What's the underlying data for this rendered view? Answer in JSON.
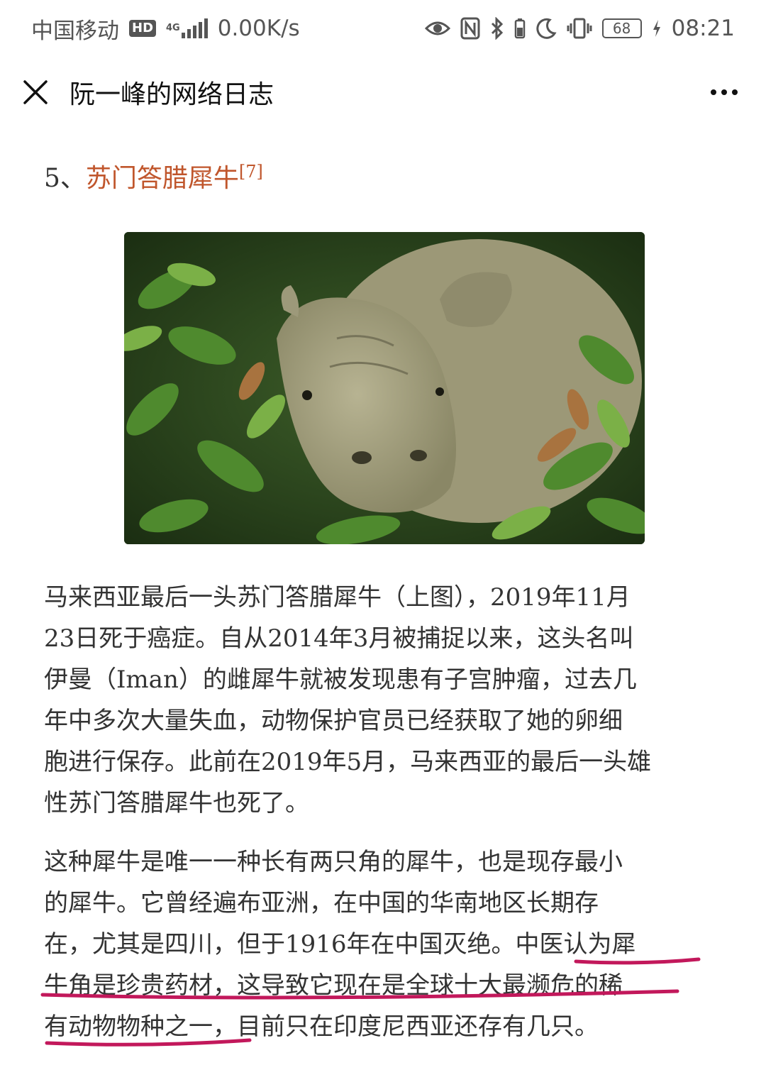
{
  "status_bar": {
    "carrier": "中国移动",
    "hd_badge": "HD",
    "network": "4G",
    "speed": "0.00K/s",
    "battery": "68",
    "time": "08:21",
    "icons": [
      "eye-icon",
      "nfc-icon",
      "bluetooth-icon",
      "moon-icon",
      "vibrate-icon",
      "battery-icon",
      "charging-icon"
    ]
  },
  "header": {
    "title": "阮一峰的网络日志",
    "close_icon": "close-icon",
    "more_icon": "more-icon"
  },
  "article": {
    "section_number": "5、",
    "section_link": "苏门答腊犀牛",
    "section_ref": "[7]",
    "photo": "rhinoceros-photo",
    "paragraph1_lines": [
      "马来西亚最后一头苏门答腊犀牛（上图），2019年11月",
      "23日死于癌症。自从2014年3月被捕捉以来，这头名叫",
      "伊曼（Iman）的雌犀牛就被发现患有子宫肿瘤，过去几",
      "年中多次大量失血，动物保护官员已经获取了她的卵细",
      "胞进行保存。此前在2019年5月，马来西亚的最后一头雄",
      "性苏门答腊犀牛也死了。"
    ],
    "paragraph2_lines": [
      "这种犀牛是唯一一种长有两只角的犀牛，也是现存最小",
      "的犀牛。它曾经遍布亚洲，在中国的华南地区长期存",
      "在，尤其是四川，但于1916年在中国灭绝。中医认为犀",
      "牛角是珍贵药材，这导致它现在是全球十大最濒危的稀",
      "有动物物种之一，目前只在印度尼西亚还存有几只。"
    ],
    "annotation_color": "#c2185b"
  }
}
